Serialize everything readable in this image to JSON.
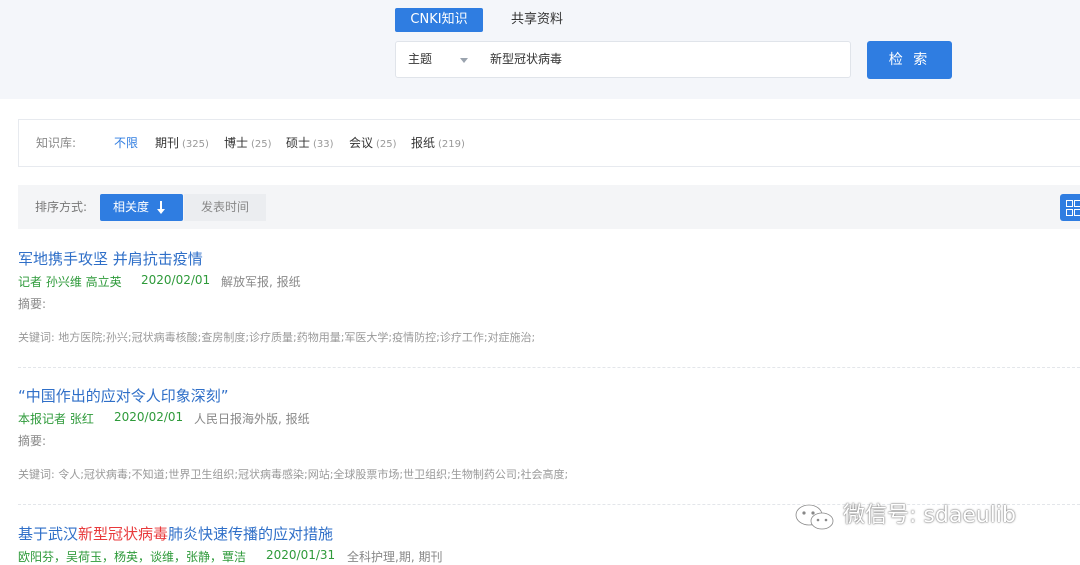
{
  "tabs": {
    "cnki": "CNKI知识",
    "share": "共享资料"
  },
  "search": {
    "field": "主题",
    "query": "新型冠状病毒",
    "button": "检 索"
  },
  "kb": {
    "label": "知识库:",
    "items": [
      {
        "label": "不限",
        "count": ""
      },
      {
        "label": "期刊",
        "count": "(325)"
      },
      {
        "label": "博士",
        "count": "(25)"
      },
      {
        "label": "硕士",
        "count": "(33)"
      },
      {
        "label": "会议",
        "count": "(25)"
      },
      {
        "label": "报纸",
        "count": "(219)"
      }
    ]
  },
  "sort": {
    "label": "排序方式:",
    "relevance": "相关度",
    "date": "发表时间"
  },
  "results": [
    {
      "title": "军地携手攻坚 并肩抗击疫情",
      "authors": "记者 孙兴维 高立英",
      "date": "2020/02/01",
      "source": "解放军报, 报纸",
      "abstract": "摘要:",
      "keywords": "关键词: 地方医院;孙兴;冠状病毒核酸;查房制度;诊疗质量;药物用量;军医大学;疫情防控;诊疗工作;对症施治;"
    },
    {
      "title": "“中国作出的应对令人印象深刻”",
      "authors": "本报记者 张红",
      "date": "2020/02/01",
      "source": "人民日报海外版, 报纸",
      "abstract": "摘要:",
      "keywords": "关键词: 令人;冠状病毒;不知道;世界卫生组织;冠状病毒感染;网站;全球股票市场;世卫组织;生物制药公司;社会高度;"
    },
    {
      "title_pre": "基于武汉",
      "title_hl": "新型冠状病毒",
      "title_post": "肺炎快速传播的应对措施",
      "authors": "欧阳芬，吴荷玉，杨英，谈维，张静，覃洁",
      "date": "2020/01/31",
      "source": "全科护理,期, 期刊"
    }
  ],
  "watermark": "微信号: sdaeulib",
  "colors": {
    "accent": "#2f7de1",
    "author": "#2e9a3a",
    "highlight": "#e8393b",
    "title": "#2f6fc8"
  }
}
